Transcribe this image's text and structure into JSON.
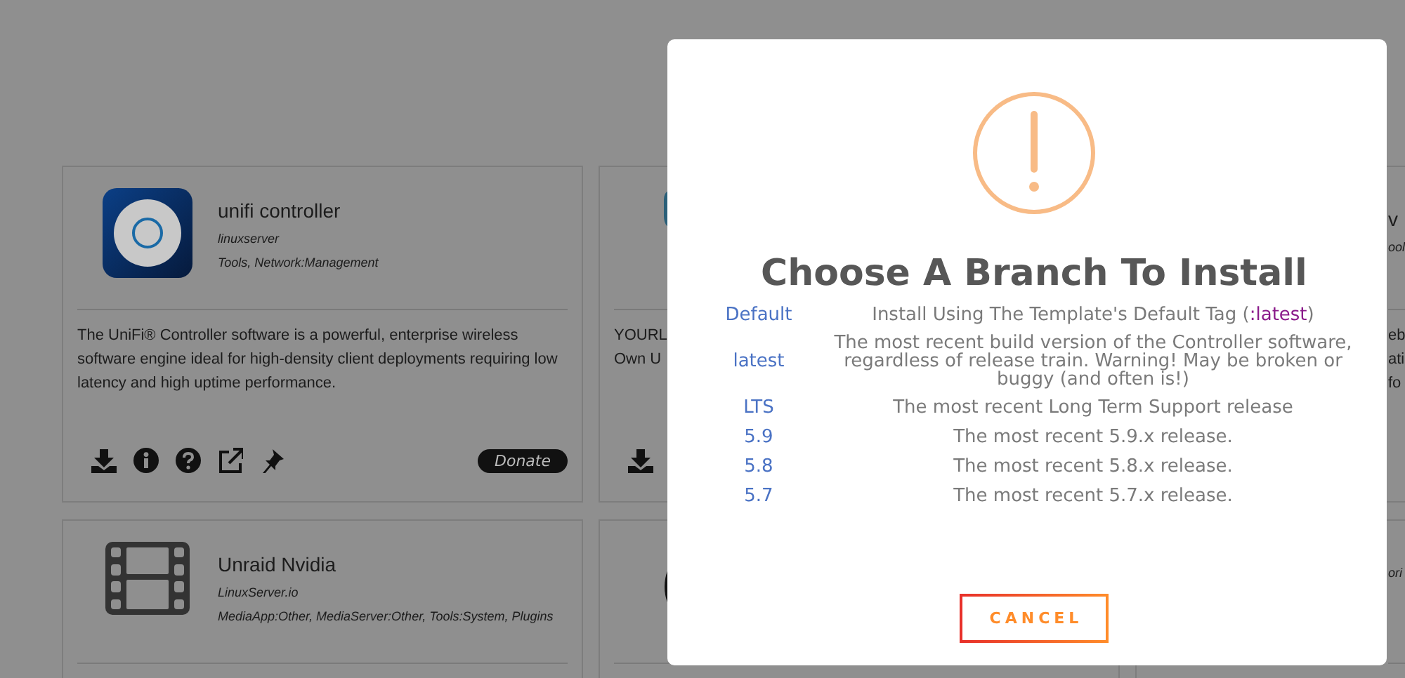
{
  "cards": [
    {
      "kind": "unifi",
      "title": "unifi controller",
      "author": "linuxserver",
      "categories": "Tools, Network:Management",
      "description": "The UniFi® Controller software is a powerful, enterprise wireless software engine ideal for high-density client deployments requiring low latency and high uptime performance.",
      "actions": [
        {
          "kind": "download"
        },
        {
          "kind": "info"
        },
        {
          "kind": "help"
        },
        {
          "kind": "link"
        },
        {
          "kind": "pin"
        }
      ],
      "donate": "Donate"
    },
    {
      "kind": "yourls",
      "description": "YOURL\nOwn U",
      "actions": [
        {
          "kind": "download"
        }
      ]
    },
    {
      "kind": "text",
      "title": "v",
      "categories": "ool",
      "description": "eb\nati\nfo"
    },
    {
      "kind": "film",
      "title": "Unraid Nvidia",
      "author": "LinuxServer.io",
      "categories": "MediaApp:Other, MediaServer:Other, Tools:System, Plugins"
    },
    {
      "kind": "bowl"
    },
    {
      "kind": "text",
      "categories": "ori"
    }
  ],
  "modal": {
    "title": "Choose A Branch To Install",
    "branches": [
      {
        "tag": "Default",
        "description": [
          {
            "kind": "plain",
            "text": "Install Using The Template's Default Tag ("
          },
          {
            "kind": "tag",
            "text": ":latest"
          },
          {
            "kind": "plain",
            "text": ")"
          }
        ]
      },
      {
        "tag": "latest",
        "description": [
          {
            "kind": "plain",
            "text": "The most recent build version of the Controller software, regardless of release train. Warning! May be broken or buggy (and often is!)"
          }
        ]
      },
      {
        "tag": "LTS",
        "description": [
          {
            "kind": "plain",
            "text": "The most recent Long Term Support release"
          }
        ]
      },
      {
        "tag": "5.9",
        "description": [
          {
            "kind": "plain",
            "text": "The most recent 5.9.x release."
          }
        ]
      },
      {
        "tag": "5.8",
        "description": [
          {
            "kind": "plain",
            "text": "The most recent 5.8.x release."
          }
        ]
      },
      {
        "tag": "5.7",
        "description": [
          {
            "kind": "plain",
            "text": "The most recent 5.7.x release."
          }
        ]
      }
    ],
    "cancel": "CANCEL"
  }
}
